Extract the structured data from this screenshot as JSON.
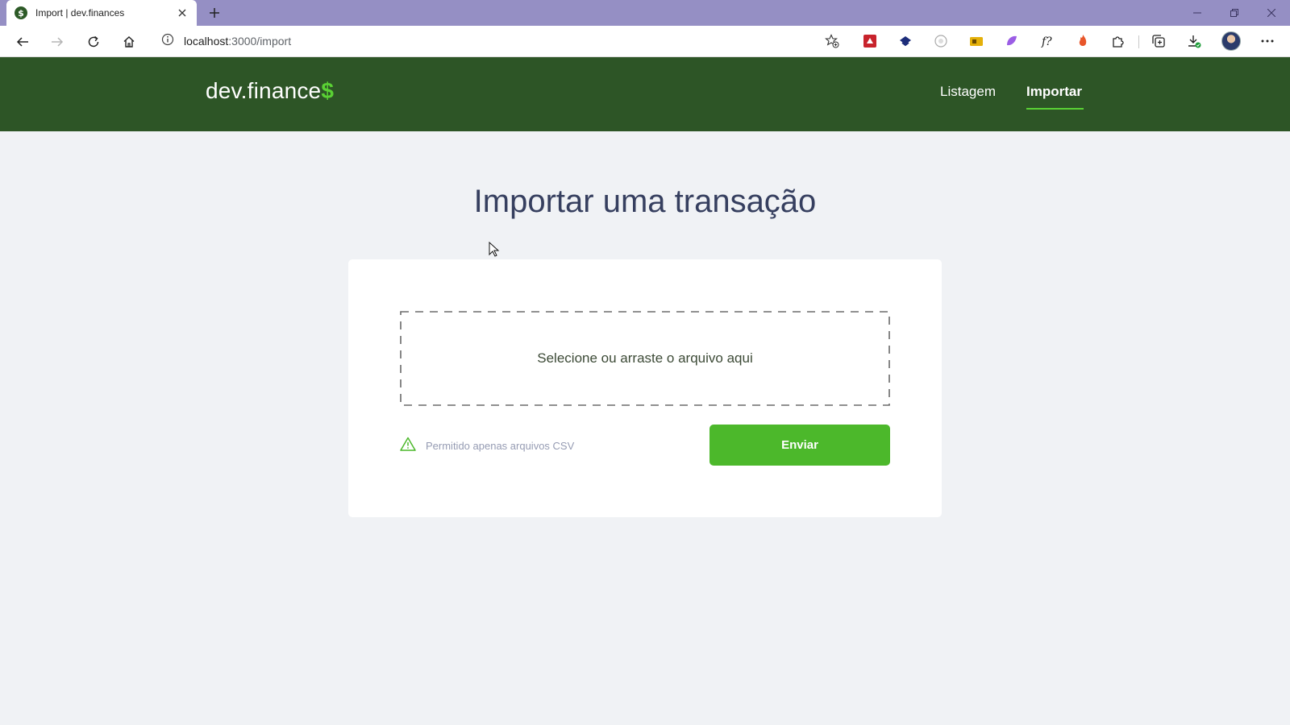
{
  "browser": {
    "tab": {
      "title": "Import | dev.finances",
      "favicon": "$"
    },
    "address": {
      "host": "localhost",
      "path": ":3000/import"
    }
  },
  "header": {
    "logo_main": "dev.finance",
    "logo_accent": "$",
    "nav": [
      {
        "label": "Listagem",
        "active": false
      },
      {
        "label": "Importar",
        "active": true
      }
    ]
  },
  "main": {
    "title": "Importar uma transação",
    "dropzone_label": "Selecione ou arraste o arquivo aqui",
    "hint": "Permitido apenas arquivos CSV",
    "submit_label": "Enviar"
  },
  "colors": {
    "header_bg": "#2d5526",
    "accent": "#5ad134",
    "button": "#4cb82b",
    "page_bg": "#f0f2f5",
    "title": "#363f5f"
  }
}
